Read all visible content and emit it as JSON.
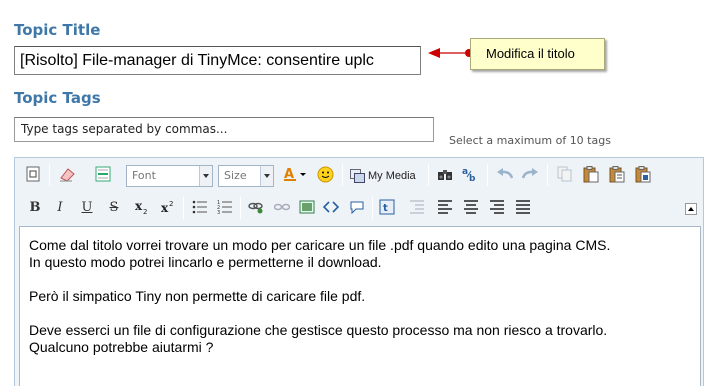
{
  "topic_title": {
    "heading": "Topic Title",
    "value": "[Risolto] File-manager di TinyMce: consentire uplc"
  },
  "tooltip": {
    "text": "Modifica il titolo"
  },
  "topic_tags": {
    "heading": "Topic Tags",
    "placeholder": "Type tags separated by commas...",
    "hint": "Select a maximum of 10 tags"
  },
  "editor": {
    "toolbar1": {
      "font_select": "Font",
      "size_select": "Size",
      "mymedia_label": "My Media"
    },
    "toolbar2": {
      "bold": "B",
      "italic": "I",
      "underline": "U",
      "strike": "S"
    },
    "content_lines": [
      "Come dal titolo vorrei trovare un modo per caricare un file .pdf quando edito una pagina CMS.",
      "In questo modo potrei lincarlo e permetterne il download.",
      "",
      "Però il simpatico Tiny non permette di caricare file pdf.",
      "",
      "Deve esserci un file di configurazione che gestisce questo processo ma non riesco a trovarlo.",
      "Qualcuno potrebbe aiutarmi ?"
    ]
  },
  "colors": {
    "heading": "#3f78a8",
    "arrow": "#cc0000",
    "tooltip_bg": "#ffffcc",
    "toolbar_bg": "#eef3f8"
  }
}
